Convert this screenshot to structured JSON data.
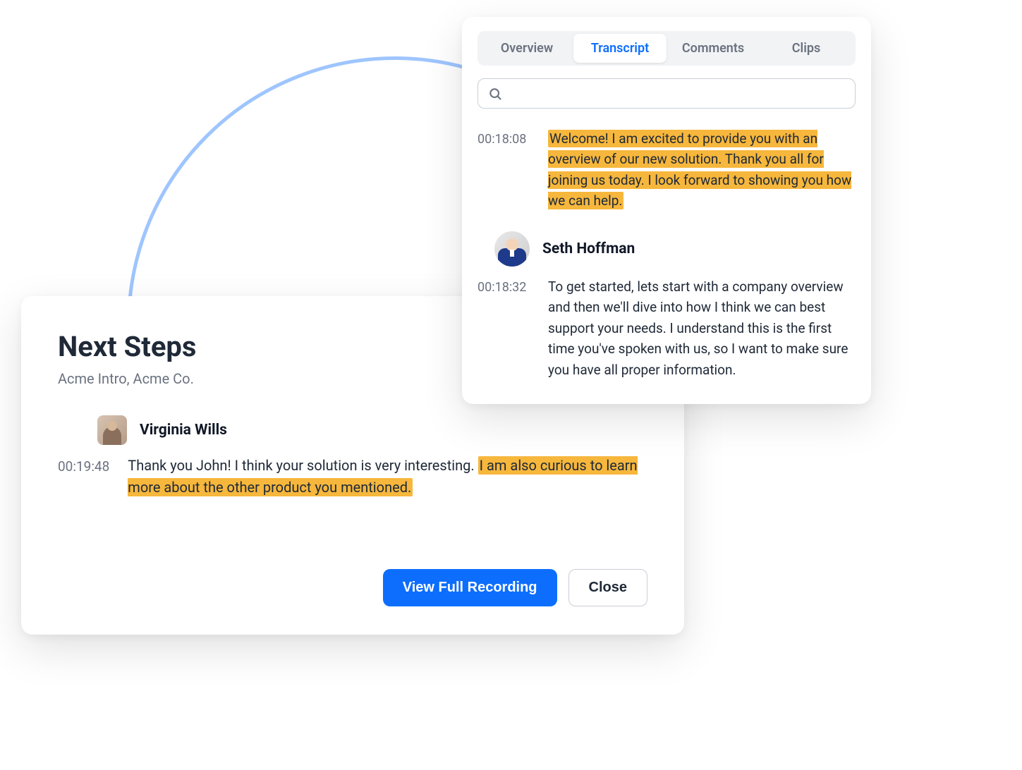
{
  "next_steps": {
    "title": "Next Steps",
    "subtitle": "Acme Intro, Acme Co.",
    "speaker": "Virginia Wills",
    "timestamp": "00:19:48",
    "text_plain_prefix": "Thank you John! I think your solution is very interesting. ",
    "text_highlight_tail": "I am also curious to learn more about the other product you mentioned.",
    "buttons": {
      "primary": "View Full Recording",
      "secondary": "Close"
    }
  },
  "transcript_panel": {
    "tabs": {
      "overview": "Overview",
      "transcript": "Transcript",
      "comments": "Comments",
      "clips": "Clips"
    },
    "search_placeholder": "",
    "entries": [
      {
        "timestamp": "00:18:08",
        "highlighted": true,
        "text": "Welcome! I am excited to provide you with an overview of our new solution. Thank you all for joining us today. I look forward to showing you how we can help."
      }
    ],
    "speaker2": "Seth Hoffman",
    "entry2": {
      "timestamp": "00:18:32",
      "text": "To get started, lets start with a company overview and then we'll dive into how I think we can best support your needs. I understand this is the first time you've spoken with us, so I want to make sure you have all proper information."
    }
  }
}
